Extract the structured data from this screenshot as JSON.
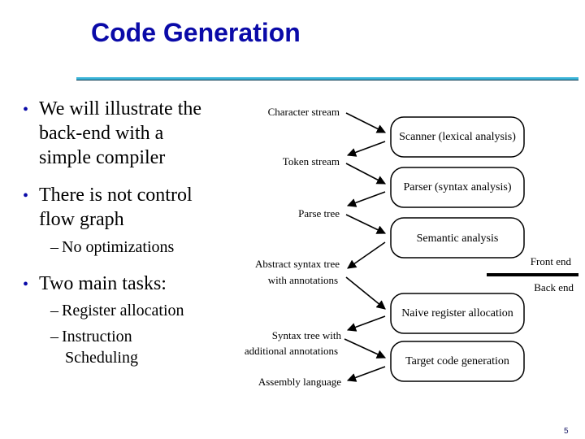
{
  "slide": {
    "title": "Code Generation",
    "page_number": "5",
    "accent_color": "#0a0aa8",
    "rule_color": "#3ab4d8"
  },
  "bullets": [
    {
      "lines": [
        "We will illustrate the",
        "back-end with a",
        "simple compiler"
      ],
      "sub": []
    },
    {
      "lines": [
        "There is not control",
        "flow graph"
      ],
      "sub": [
        {
          "lines": [
            "No optimizations"
          ]
        }
      ]
    },
    {
      "lines": [
        "Two main tasks:"
      ],
      "sub": [
        {
          "lines": [
            "Register allocation"
          ]
        },
        {
          "lines": [
            "Instruction",
            "Scheduling"
          ]
        }
      ]
    }
  ],
  "diagram": {
    "phases": [
      "Scanner (lexical analysis)",
      "Parser (syntax analysis)",
      "Semantic analysis",
      "Naive register allocation",
      "Target code generation"
    ],
    "artifacts": [
      [
        "Character stream"
      ],
      [
        "Token stream"
      ],
      [
        "Parse tree"
      ],
      [
        "Abstract syntax tree",
        "with annotations"
      ],
      [
        "Syntax tree with",
        "additional annotations"
      ],
      [
        "Assembly language"
      ]
    ],
    "divider_labels": {
      "front": "Front end",
      "back": "Back end"
    }
  }
}
